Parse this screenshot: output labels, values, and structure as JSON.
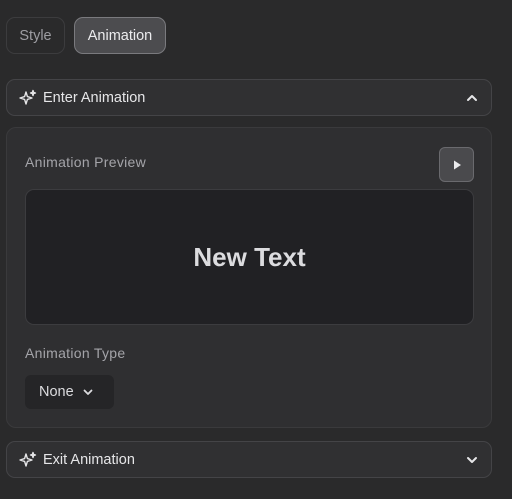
{
  "tabs": [
    {
      "label": "Style",
      "active": false
    },
    {
      "label": "Animation",
      "active": true
    }
  ],
  "enter_section": {
    "title": "Enter Animation",
    "expanded": true
  },
  "preview": {
    "label": "Animation Preview",
    "text": "New Text"
  },
  "animation_type": {
    "label": "Animation Type",
    "selected": "None"
  },
  "exit_section": {
    "title": "Exit Animation",
    "expanded": false
  },
  "colors": {
    "background": "#2a2a2b",
    "active_tab": "#4c4c4f",
    "preview_bg": "#212124"
  },
  "icons": {
    "section": "sparkles-icon",
    "play": "play-icon",
    "expand": "chevron-up-icon",
    "collapse": "chevron-down-icon"
  }
}
